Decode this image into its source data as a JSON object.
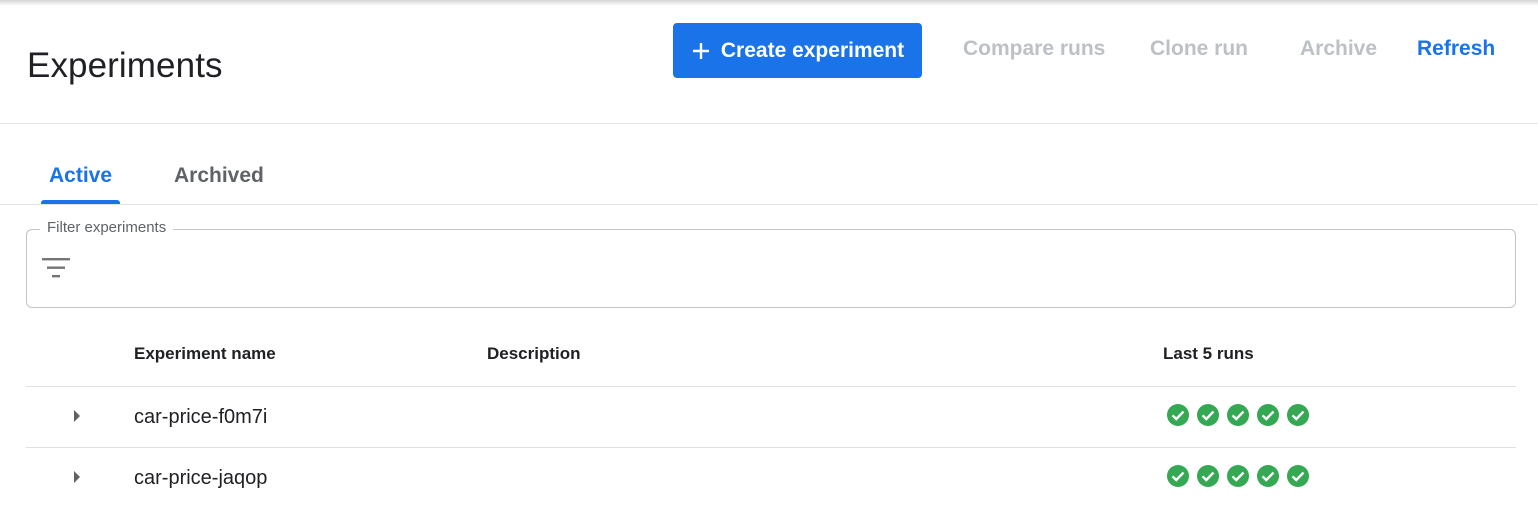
{
  "header": {
    "title": "Experiments",
    "create_label": "Create experiment",
    "compare_label": "Compare runs",
    "clone_label": "Clone run",
    "archive_label": "Archive",
    "refresh_label": "Refresh"
  },
  "tabs": [
    {
      "label": "Active",
      "selected": true
    },
    {
      "label": "Archived",
      "selected": false
    }
  ],
  "filter": {
    "label": "Filter experiments",
    "value": "",
    "icon": "filter-list-icon"
  },
  "table": {
    "columns": [
      "Experiment name",
      "Description",
      "Last 5 runs"
    ],
    "rows": [
      {
        "name": "car-price-f0m7i",
        "description": "",
        "last_runs": [
          "succeeded",
          "succeeded",
          "succeeded",
          "succeeded",
          "succeeded"
        ]
      },
      {
        "name": "car-price-jaqop",
        "description": "",
        "last_runs": [
          "succeeded",
          "succeeded",
          "succeeded",
          "succeeded",
          "succeeded"
        ]
      }
    ]
  },
  "icons": {
    "create": "plus-icon",
    "expand": "triangle-right-icon",
    "run_status": "check-circle-icon"
  },
  "colors": {
    "accent": "#1a73e8",
    "disabled_text": "#bdc1c6",
    "success": "#34a853"
  }
}
